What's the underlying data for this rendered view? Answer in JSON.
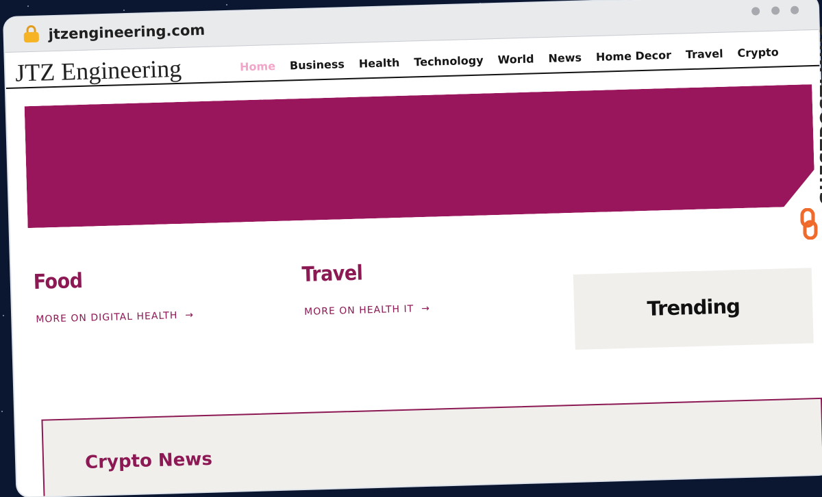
{
  "browser": {
    "url": "jtzengineering.com",
    "lock_icon": "lock-icon"
  },
  "site": {
    "logo": "JTZ Engineering",
    "nav": [
      "Home",
      "Business",
      "Health",
      "Technology",
      "World",
      "News",
      "Home Decor",
      "Travel",
      "Crypto"
    ],
    "active_nav": "Home"
  },
  "colors": {
    "brand": "#9a165c",
    "accent_text": "#8c1854",
    "active_nav": "#f0a6c8",
    "panel_bg": "#f0efec"
  },
  "categories": [
    {
      "title": "Food",
      "more": "MORE ON DIGITAL HEALTH"
    },
    {
      "title": "Travel",
      "more": "MORE ON HEALTH IT"
    }
  ],
  "trending": {
    "title": "Trending"
  },
  "crypto_news": {
    "title": "Crypto News"
  },
  "watermark": {
    "text": "GUESTPOSTLINKS",
    "icon": "chain-link-icon"
  }
}
